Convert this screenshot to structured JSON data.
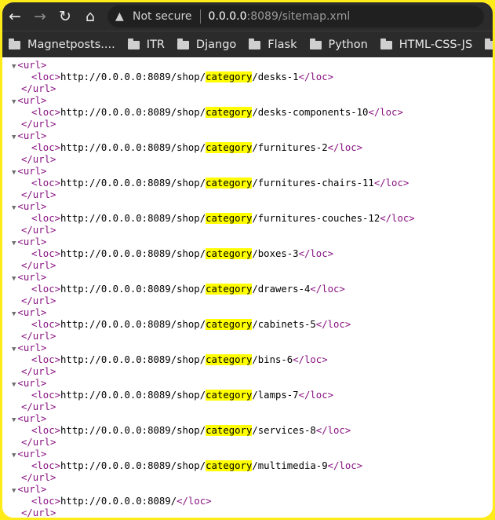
{
  "browser": {
    "security_label": "Not secure",
    "url_host": "0.0.0.0",
    "url_path": ":8089/sitemap.xml",
    "back_icon": "←",
    "forward_icon": "→",
    "reload_icon": "↻",
    "home_icon": "⌂",
    "warning_icon": "▲"
  },
  "bookmarks": [
    "Magnetposts....",
    "ITR",
    "Django",
    "Flask",
    "Python",
    "HTML-CSS-JS"
  ],
  "xml": {
    "open_url": "<url>",
    "close_url": "</url>",
    "open_loc": "<loc>",
    "close_loc": "</loc>",
    "triangle": "▼",
    "highlight_term": "category",
    "entries": [
      {
        "prefix": "http://0.0.0.0:8089/shop/",
        "highlight": "category",
        "suffix": "/desks-1"
      },
      {
        "prefix": "http://0.0.0.0:8089/shop/",
        "highlight": "category",
        "suffix": "/desks-components-10"
      },
      {
        "prefix": "http://0.0.0.0:8089/shop/",
        "highlight": "category",
        "suffix": "/furnitures-2"
      },
      {
        "prefix": "http://0.0.0.0:8089/shop/",
        "highlight": "category",
        "suffix": "/furnitures-chairs-11"
      },
      {
        "prefix": "http://0.0.0.0:8089/shop/",
        "highlight": "category",
        "suffix": "/furnitures-couches-12"
      },
      {
        "prefix": "http://0.0.0.0:8089/shop/",
        "highlight": "category",
        "suffix": "/boxes-3"
      },
      {
        "prefix": "http://0.0.0.0:8089/shop/",
        "highlight": "category",
        "suffix": "/drawers-4"
      },
      {
        "prefix": "http://0.0.0.0:8089/shop/",
        "highlight": "category",
        "suffix": "/cabinets-5"
      },
      {
        "prefix": "http://0.0.0.0:8089/shop/",
        "highlight": "category",
        "suffix": "/bins-6"
      },
      {
        "prefix": "http://0.0.0.0:8089/shop/",
        "highlight": "category",
        "suffix": "/lamps-7"
      },
      {
        "prefix": "http://0.0.0.0:8089/shop/",
        "highlight": "category",
        "suffix": "/services-8"
      },
      {
        "prefix": "http://0.0.0.0:8089/shop/",
        "highlight": "category",
        "suffix": "/multimedia-9"
      },
      {
        "prefix": "http://0.0.0.0:8089/",
        "highlight": "",
        "suffix": ""
      }
    ]
  }
}
